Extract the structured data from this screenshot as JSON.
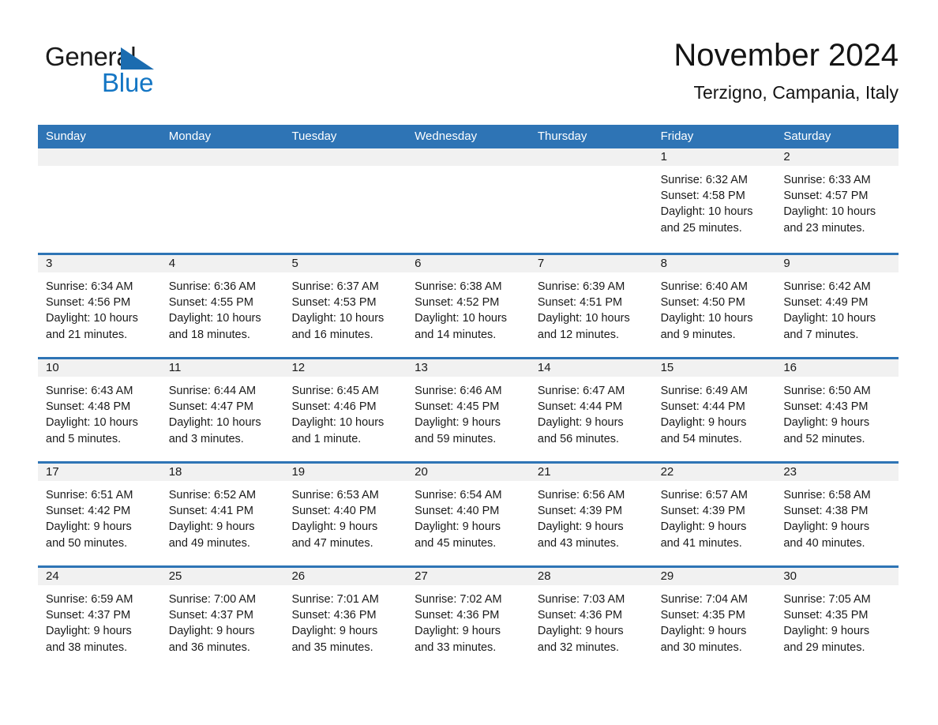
{
  "logo": {
    "word_one": "General",
    "word_two": "Blue",
    "triangle_color": "#1b6cb0",
    "blue_text_color": "#1476c4"
  },
  "header": {
    "title": "November 2024",
    "subtitle": "Terzigno, Campania, Italy"
  },
  "theme": {
    "header_blue": "#2e74b5",
    "day_band_gray": "#f1f1f1",
    "text_color": "#1a1a1a",
    "background": "#ffffff"
  },
  "weekdays": [
    "Sunday",
    "Monday",
    "Tuesday",
    "Wednesday",
    "Thursday",
    "Friday",
    "Saturday"
  ],
  "weeks": [
    [
      {
        "day": "",
        "lines": []
      },
      {
        "day": "",
        "lines": []
      },
      {
        "day": "",
        "lines": []
      },
      {
        "day": "",
        "lines": []
      },
      {
        "day": "",
        "lines": []
      },
      {
        "day": "1",
        "lines": [
          "Sunrise: 6:32 AM",
          "Sunset: 4:58 PM",
          "Daylight: 10 hours",
          "and 25 minutes."
        ]
      },
      {
        "day": "2",
        "lines": [
          "Sunrise: 6:33 AM",
          "Sunset: 4:57 PM",
          "Daylight: 10 hours",
          "and 23 minutes."
        ]
      }
    ],
    [
      {
        "day": "3",
        "lines": [
          "Sunrise: 6:34 AM",
          "Sunset: 4:56 PM",
          "Daylight: 10 hours",
          "and 21 minutes."
        ]
      },
      {
        "day": "4",
        "lines": [
          "Sunrise: 6:36 AM",
          "Sunset: 4:55 PM",
          "Daylight: 10 hours",
          "and 18 minutes."
        ]
      },
      {
        "day": "5",
        "lines": [
          "Sunrise: 6:37 AM",
          "Sunset: 4:53 PM",
          "Daylight: 10 hours",
          "and 16 minutes."
        ]
      },
      {
        "day": "6",
        "lines": [
          "Sunrise: 6:38 AM",
          "Sunset: 4:52 PM",
          "Daylight: 10 hours",
          "and 14 minutes."
        ]
      },
      {
        "day": "7",
        "lines": [
          "Sunrise: 6:39 AM",
          "Sunset: 4:51 PM",
          "Daylight: 10 hours",
          "and 12 minutes."
        ]
      },
      {
        "day": "8",
        "lines": [
          "Sunrise: 6:40 AM",
          "Sunset: 4:50 PM",
          "Daylight: 10 hours",
          "and 9 minutes."
        ]
      },
      {
        "day": "9",
        "lines": [
          "Sunrise: 6:42 AM",
          "Sunset: 4:49 PM",
          "Daylight: 10 hours",
          "and 7 minutes."
        ]
      }
    ],
    [
      {
        "day": "10",
        "lines": [
          "Sunrise: 6:43 AM",
          "Sunset: 4:48 PM",
          "Daylight: 10 hours",
          "and 5 minutes."
        ]
      },
      {
        "day": "11",
        "lines": [
          "Sunrise: 6:44 AM",
          "Sunset: 4:47 PM",
          "Daylight: 10 hours",
          "and 3 minutes."
        ]
      },
      {
        "day": "12",
        "lines": [
          "Sunrise: 6:45 AM",
          "Sunset: 4:46 PM",
          "Daylight: 10 hours",
          "and 1 minute."
        ]
      },
      {
        "day": "13",
        "lines": [
          "Sunrise: 6:46 AM",
          "Sunset: 4:45 PM",
          "Daylight: 9 hours",
          "and 59 minutes."
        ]
      },
      {
        "day": "14",
        "lines": [
          "Sunrise: 6:47 AM",
          "Sunset: 4:44 PM",
          "Daylight: 9 hours",
          "and 56 minutes."
        ]
      },
      {
        "day": "15",
        "lines": [
          "Sunrise: 6:49 AM",
          "Sunset: 4:44 PM",
          "Daylight: 9 hours",
          "and 54 minutes."
        ]
      },
      {
        "day": "16",
        "lines": [
          "Sunrise: 6:50 AM",
          "Sunset: 4:43 PM",
          "Daylight: 9 hours",
          "and 52 minutes."
        ]
      }
    ],
    [
      {
        "day": "17",
        "lines": [
          "Sunrise: 6:51 AM",
          "Sunset: 4:42 PM",
          "Daylight: 9 hours",
          "and 50 minutes."
        ]
      },
      {
        "day": "18",
        "lines": [
          "Sunrise: 6:52 AM",
          "Sunset: 4:41 PM",
          "Daylight: 9 hours",
          "and 49 minutes."
        ]
      },
      {
        "day": "19",
        "lines": [
          "Sunrise: 6:53 AM",
          "Sunset: 4:40 PM",
          "Daylight: 9 hours",
          "and 47 minutes."
        ]
      },
      {
        "day": "20",
        "lines": [
          "Sunrise: 6:54 AM",
          "Sunset: 4:40 PM",
          "Daylight: 9 hours",
          "and 45 minutes."
        ]
      },
      {
        "day": "21",
        "lines": [
          "Sunrise: 6:56 AM",
          "Sunset: 4:39 PM",
          "Daylight: 9 hours",
          "and 43 minutes."
        ]
      },
      {
        "day": "22",
        "lines": [
          "Sunrise: 6:57 AM",
          "Sunset: 4:39 PM",
          "Daylight: 9 hours",
          "and 41 minutes."
        ]
      },
      {
        "day": "23",
        "lines": [
          "Sunrise: 6:58 AM",
          "Sunset: 4:38 PM",
          "Daylight: 9 hours",
          "and 40 minutes."
        ]
      }
    ],
    [
      {
        "day": "24",
        "lines": [
          "Sunrise: 6:59 AM",
          "Sunset: 4:37 PM",
          "Daylight: 9 hours",
          "and 38 minutes."
        ]
      },
      {
        "day": "25",
        "lines": [
          "Sunrise: 7:00 AM",
          "Sunset: 4:37 PM",
          "Daylight: 9 hours",
          "and 36 minutes."
        ]
      },
      {
        "day": "26",
        "lines": [
          "Sunrise: 7:01 AM",
          "Sunset: 4:36 PM",
          "Daylight: 9 hours",
          "and 35 minutes."
        ]
      },
      {
        "day": "27",
        "lines": [
          "Sunrise: 7:02 AM",
          "Sunset: 4:36 PM",
          "Daylight: 9 hours",
          "and 33 minutes."
        ]
      },
      {
        "day": "28",
        "lines": [
          "Sunrise: 7:03 AM",
          "Sunset: 4:36 PM",
          "Daylight: 9 hours",
          "and 32 minutes."
        ]
      },
      {
        "day": "29",
        "lines": [
          "Sunrise: 7:04 AM",
          "Sunset: 4:35 PM",
          "Daylight: 9 hours",
          "and 30 minutes."
        ]
      },
      {
        "day": "30",
        "lines": [
          "Sunrise: 7:05 AM",
          "Sunset: 4:35 PM",
          "Daylight: 9 hours",
          "and 29 minutes."
        ]
      }
    ]
  ]
}
